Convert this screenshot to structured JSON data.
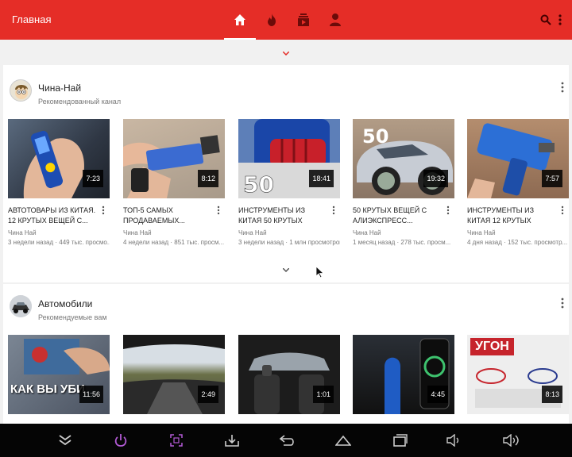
{
  "header": {
    "title": "Главная"
  },
  "shelves": [
    {
      "title": "Чина-Най",
      "subtitle": "Рекомендованный канал",
      "videos": [
        {
          "title": "АВТОТОВАРЫ ИЗ КИТАЯ. 12 КРУТЫХ ВЕЩЕЙ С...",
          "channel": "Чина Най",
          "meta": "3 недели назад · 449 тыс. просмо...",
          "duration": "7:23"
        },
        {
          "title": "ТОП-5 САМЫХ ПРОДАВАЕМЫХ...",
          "channel": "Чина Най",
          "meta": "4 недели назад · 851 тыс. просм...",
          "duration": "8:12"
        },
        {
          "title": "ИНСТРУМЕНТЫ ИЗ КИТАЯ 50 КРУТЫХ ВЕЩЕЙ...",
          "channel": "Чина Най",
          "meta": "3 недели назад · 1 млн просмотров",
          "duration": "18:41"
        },
        {
          "title": "50 КРУТЫХ ВЕЩЕЙ С АЛИЭКСПРЕСС...",
          "channel": "Чина Най",
          "meta": "1 месяц назад · 278 тыс. просм...",
          "duration": "19:32"
        },
        {
          "title": "ИНСТРУМЕНТЫ ИЗ КИТАЯ 12 КРУТЫХ ВЕЩЕЙ С...",
          "channel": "Чина Най",
          "meta": "4 дня назад · 152 тыс. просмотр...",
          "duration": "7:57"
        }
      ]
    },
    {
      "title": "Автомобили",
      "subtitle": "Рекомендуемые вам",
      "videos": [
        {
          "title": "",
          "overlay": "КАК ВЫ УБИ",
          "duration": "11:56"
        },
        {
          "title": "",
          "duration": "2:49"
        },
        {
          "title": "",
          "duration": "1:01"
        },
        {
          "title": "",
          "duration": "4:45"
        },
        {
          "title": "",
          "overlay": "УГОН",
          "duration": "8:13"
        }
      ]
    }
  ],
  "colors": {
    "brand": "#e52d27",
    "navbar": "#050505"
  }
}
